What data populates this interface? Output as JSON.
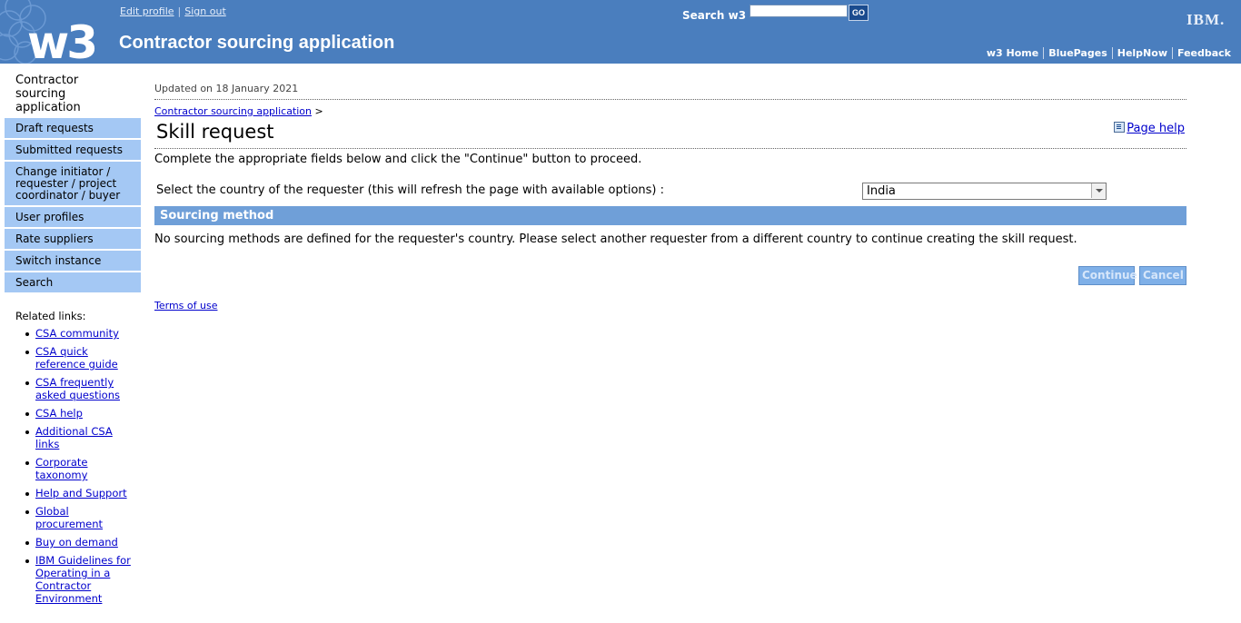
{
  "masthead": {
    "logo_text": "w3",
    "edit_profile": "Edit profile",
    "sign_out": "Sign out",
    "app_title": "Contractor sourcing application",
    "search_label": "Search w3",
    "search_value": "",
    "go_label": "GO",
    "ibm_logo": "IBM.",
    "nav": [
      "w3 Home",
      "BluePages",
      "HelpNow",
      "Feedback"
    ],
    "colors": {
      "bar": "#4a7ebe",
      "go": "#1a4b8e"
    }
  },
  "sidebar": {
    "title": "Contractor sourcing application",
    "items": [
      "Draft requests",
      "Submitted requests",
      "Change initiator / requester / project coordinator / buyer",
      "User profiles",
      "Rate suppliers",
      "Switch instance",
      "Search"
    ],
    "related_title": "Related links:",
    "related_links": [
      "CSA community",
      "CSA quick reference guide",
      "CSA frequently asked questions",
      "CSA help",
      "Additional CSA links",
      "Corporate taxonomy",
      "Help and Support",
      "Global procurement",
      "Buy on demand",
      "IBM Guidelines for Operating in a Contractor Environment"
    ],
    "colors": {
      "item_bg": "#a4c8f4"
    }
  },
  "main": {
    "updated": "Updated on 18 January 2021",
    "breadcrumb_link": "Contractor sourcing application",
    "breadcrumb_sep": ">",
    "heading": "Skill request",
    "page_help": "Page help",
    "instructions": "Complete the appropriate fields below and click the \"Continue\" button to proceed.",
    "country_label": "Select the country of the requester (this will refresh the page with available options) :",
    "country_value": "India",
    "section_title": "Sourcing method",
    "message": "No sourcing methods are defined for the requester's country. Please select another requester from a different country to continue creating the skill request.",
    "continue_label": "Continue",
    "cancel_label": "Cancel",
    "terms": "Terms of use",
    "colors": {
      "section_bar": "#6f9fd8",
      "button_disabled": "#7fb0e8"
    }
  }
}
